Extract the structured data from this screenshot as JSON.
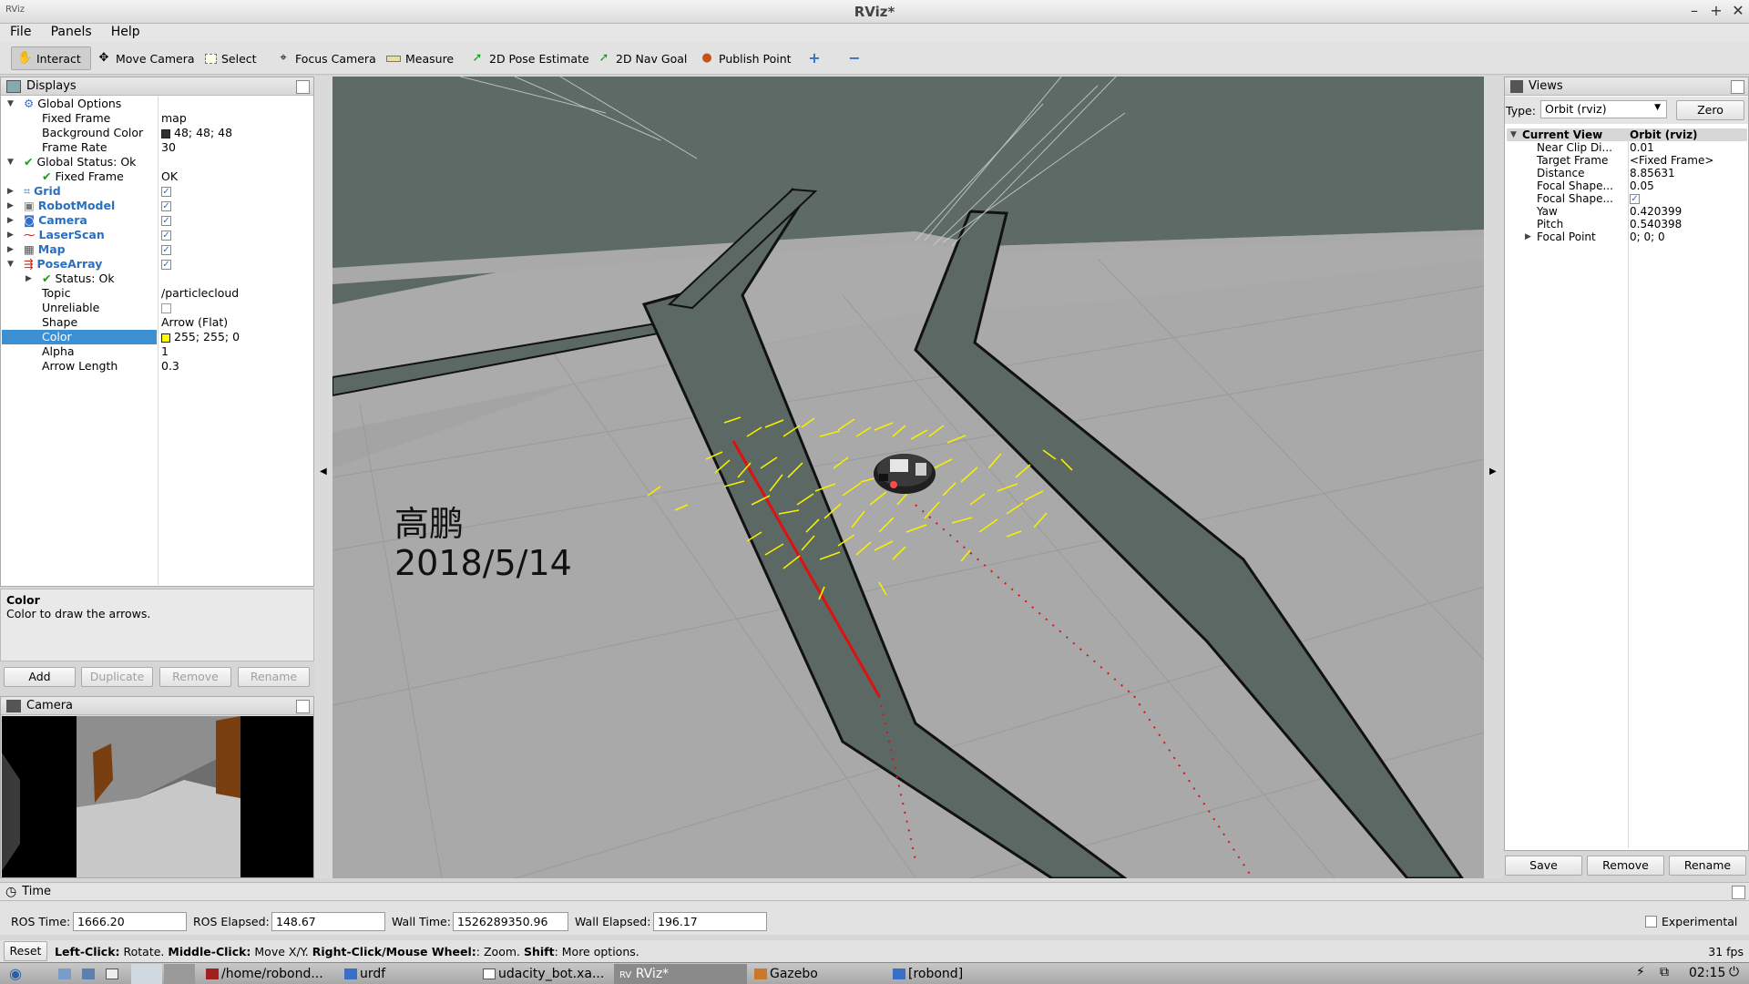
{
  "window": {
    "title": "RViz*",
    "min": "–",
    "max": "+",
    "close": "✕"
  },
  "menu": [
    "File",
    "Panels",
    "Help"
  ],
  "toolbar": [
    {
      "label": "Interact",
      "icon": "hand-icon",
      "active": true
    },
    {
      "label": "Move Camera",
      "icon": "move-camera-icon"
    },
    {
      "label": "Select",
      "icon": "select-icon"
    },
    {
      "label": "Focus Camera",
      "icon": "focus-camera-icon"
    },
    {
      "label": "Measure",
      "icon": "ruler-icon"
    },
    {
      "label": "2D Pose Estimate",
      "icon": "pose-arrow-icon"
    },
    {
      "label": "2D Nav Goal",
      "icon": "nav-goal-icon"
    },
    {
      "label": "Publish Point",
      "icon": "pin-icon"
    }
  ],
  "displays": {
    "title": "Displays",
    "global_options": "Global Options",
    "fixed_frame_label": "Fixed Frame",
    "fixed_frame_value": "map",
    "bg_color_label": "Background Color",
    "bg_color_value": "48; 48; 48",
    "frame_rate_label": "Frame Rate",
    "frame_rate_value": "30",
    "global_status": "Global Status: Ok",
    "gs_fixed_frame_label": "Fixed Frame",
    "gs_fixed_frame_value": "OK",
    "items": [
      "Grid",
      "RobotModel",
      "Camera",
      "LaserScan",
      "Map",
      "PoseArray"
    ],
    "pose_status": "Status: Ok",
    "topic_label": "Topic",
    "topic_value": "/particlecloud",
    "unreliable_label": "Unreliable",
    "shape_label": "Shape",
    "shape_value": "Arrow (Flat)",
    "color_label": "Color",
    "color_value": "255; 255; 0",
    "alpha_label": "Alpha",
    "alpha_value": "1",
    "arrow_length_label": "Arrow Length",
    "arrow_length_value": "0.3"
  },
  "description": {
    "title": "Color",
    "text": "Color to draw the arrows."
  },
  "display_buttons": {
    "add": "Add",
    "duplicate": "Duplicate",
    "remove": "Remove",
    "rename": "Rename"
  },
  "camera_panel": {
    "title": "Camera"
  },
  "overlay": {
    "name": "高鹏",
    "date": "2018/5/14"
  },
  "views": {
    "title": "Views",
    "type_label": "Type:",
    "type_value": "Orbit (rviz)",
    "zero": "Zero",
    "current_view": "Current View",
    "current_view_value": "Orbit (rviz)",
    "props": [
      {
        "k": "Near Clip Di...",
        "v": "0.01"
      },
      {
        "k": "Target Frame",
        "v": "<Fixed Frame>"
      },
      {
        "k": "Distance",
        "v": "8.85631"
      },
      {
        "k": "Focal Shape...",
        "v": "0.05"
      },
      {
        "k": "Focal Shape...",
        "v": ""
      },
      {
        "k": "Yaw",
        "v": "0.420399"
      },
      {
        "k": "Pitch",
        "v": "0.540398"
      },
      {
        "k": "Focal Point",
        "v": "0; 0; 0"
      }
    ],
    "save": "Save",
    "remove": "Remove",
    "rename": "Rename"
  },
  "time": {
    "title": "Time",
    "ros_time_label": "ROS Time:",
    "ros_time": "1666.20",
    "ros_elapsed_label": "ROS Elapsed:",
    "ros_elapsed": "148.67",
    "wall_time_label": "Wall Time:",
    "wall_time": "1526289350.96",
    "wall_elapsed_label": "Wall Elapsed:",
    "wall_elapsed": "196.17",
    "experimental": "Experimental"
  },
  "status": {
    "reset": "Reset",
    "left_click": "Left-Click:",
    "left_click_text": " Rotate. ",
    "middle_click": "Middle-Click:",
    "middle_click_text": " Move X/Y. ",
    "right_click": "Right-Click/Mouse Wheel:",
    "right_click_text": ": Zoom. ",
    "shift": "Shift",
    "shift_text": ": More options.",
    "fps": "31 fps"
  },
  "taskbar": {
    "items": [
      "/home/robond...",
      "urdf",
      "udacity_bot.xa...",
      "RViz*",
      "Gazebo",
      "[robond]"
    ],
    "clock": "02:15"
  }
}
